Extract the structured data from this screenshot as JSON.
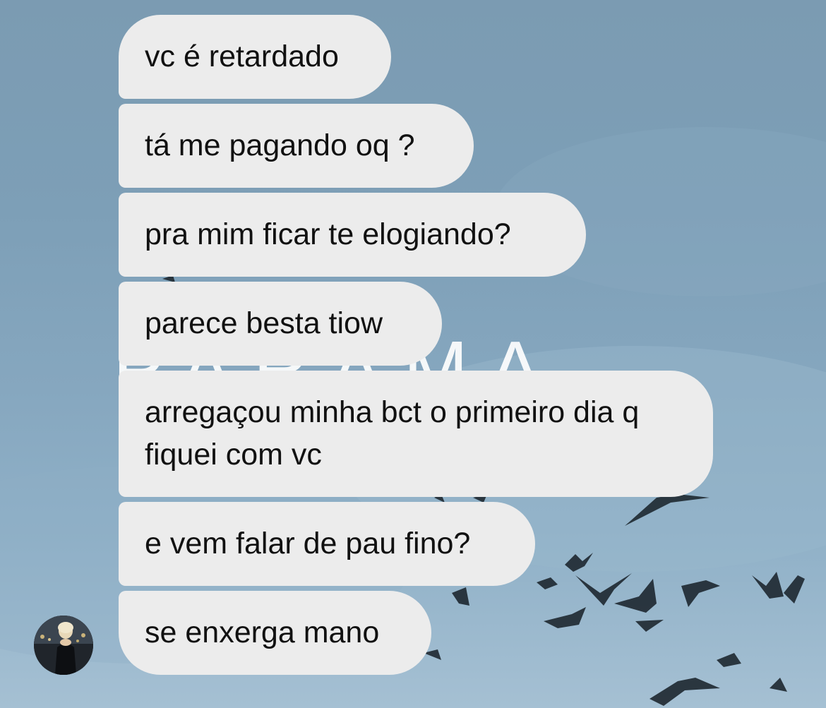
{
  "conversation": {
    "messages": [
      {
        "text": "vc é retardado"
      },
      {
        "text": "tá me pagando oq ?"
      },
      {
        "text": "pra mim ficar te elogiando?"
      },
      {
        "text": "parece besta tiow"
      },
      {
        "text": "arregaçou minha bct o primeiro dia q fiquei com vc"
      },
      {
        "text": "e vem falar de pau fino?"
      },
      {
        "text": "se enxerga mano"
      }
    ],
    "sender_avatar": {
      "icon": "user-avatar-photo"
    }
  },
  "colors": {
    "bubble_background": "#ececec",
    "bubble_text": "#111111",
    "sky_background": "#7d9fb7"
  }
}
